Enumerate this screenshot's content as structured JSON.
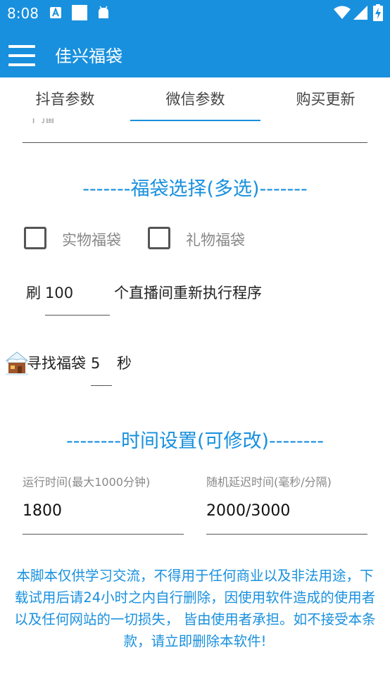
{
  "status_bar": {
    "time": "8:08",
    "left_icons": [
      "font-a-icon",
      "white-square-icon",
      "android-icon"
    ],
    "right_icons": [
      "wifi-icon",
      "signal-icon",
      "battery-charging-icon"
    ]
  },
  "app_bar": {
    "title": "佳兴福袋",
    "menu_icon": "hamburger-menu-icon",
    "background": "#1890de"
  },
  "tabs": [
    {
      "label": "抖音参数",
      "selected": false
    },
    {
      "label": "微信参数",
      "selected": true
    },
    {
      "label": "购买更新",
      "selected": false
    }
  ],
  "lucky_bag_section": {
    "title": "-------福袋选择(多选)-------",
    "options": [
      {
        "label": "实物福袋",
        "checked": false
      },
      {
        "label": "礼物福袋",
        "checked": false
      }
    ]
  },
  "refresh": {
    "prefix": "刷",
    "value": "100",
    "suffix": "个直播间重新执行程序"
  },
  "search": {
    "label": "寻找福袋",
    "value": "5",
    "unit": "秒"
  },
  "time_section": {
    "title": "--------时间设置(可修改)--------",
    "run_time": {
      "label": "运行时间(最大1000分钟)",
      "value": "1800"
    },
    "random_delay": {
      "label": "随机延迟时间(毫秒/分隔)",
      "value": "2000/3000"
    }
  },
  "disclaimer": "本脚本仅供学习交流，不得用于任何商业以及非法用途，下载试用后请24小时之内自行删除，因使用软件造成的使用者以及任何网站的一切损失， 皆由使用者承担。如不接受本条款，请立即删除本软件!",
  "colors": {
    "accent": "#1890de"
  }
}
